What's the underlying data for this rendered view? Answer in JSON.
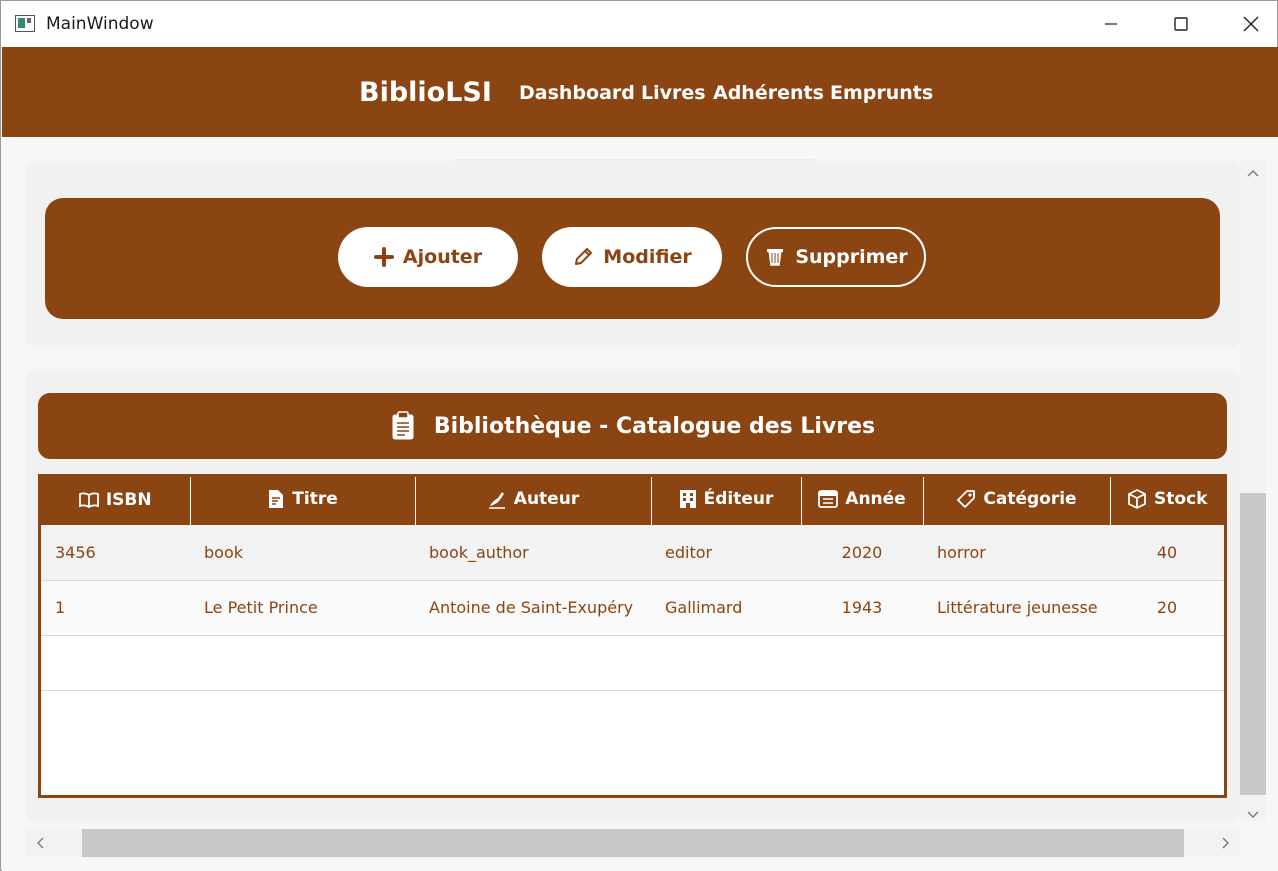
{
  "window": {
    "title": "MainWindow"
  },
  "nav": {
    "brand": "BiblioLSI",
    "items": [
      {
        "label": "Dashboard"
      },
      {
        "label": "Livres"
      },
      {
        "label": "Adhérents"
      },
      {
        "label": "Emprunts"
      }
    ]
  },
  "actions": {
    "add_label": "Ajouter",
    "edit_label": "Modifier",
    "delete_label": "Supprimer"
  },
  "catalog": {
    "title": "Bibliothèque - Catalogue des Livres",
    "columns": [
      {
        "label": "ISBN",
        "icon": "book-icon"
      },
      {
        "label": "Titre",
        "icon": "document-edit-icon"
      },
      {
        "label": "Auteur",
        "icon": "writing-hand-icon"
      },
      {
        "label": "Éditeur",
        "icon": "building-icon"
      },
      {
        "label": "Année",
        "icon": "calendar-icon"
      },
      {
        "label": "Catégorie",
        "icon": "tag-icon"
      },
      {
        "label": "Stock",
        "icon": "package-icon"
      }
    ],
    "rows": [
      {
        "isbn": "3456",
        "titre": "book",
        "auteur": "book_author",
        "editeur": "editor",
        "annee": "2020",
        "categorie": "horror",
        "stock": "40"
      },
      {
        "isbn": "1",
        "titre": "Le Petit Prince",
        "auteur": "Antoine de Saint-Exupéry",
        "editeur": "Gallimard",
        "annee": "1943",
        "categorie": "Littérature jeunesse",
        "stock": "20"
      }
    ]
  },
  "colors": {
    "brand": "#8b4513",
    "light": "#ffffff"
  }
}
